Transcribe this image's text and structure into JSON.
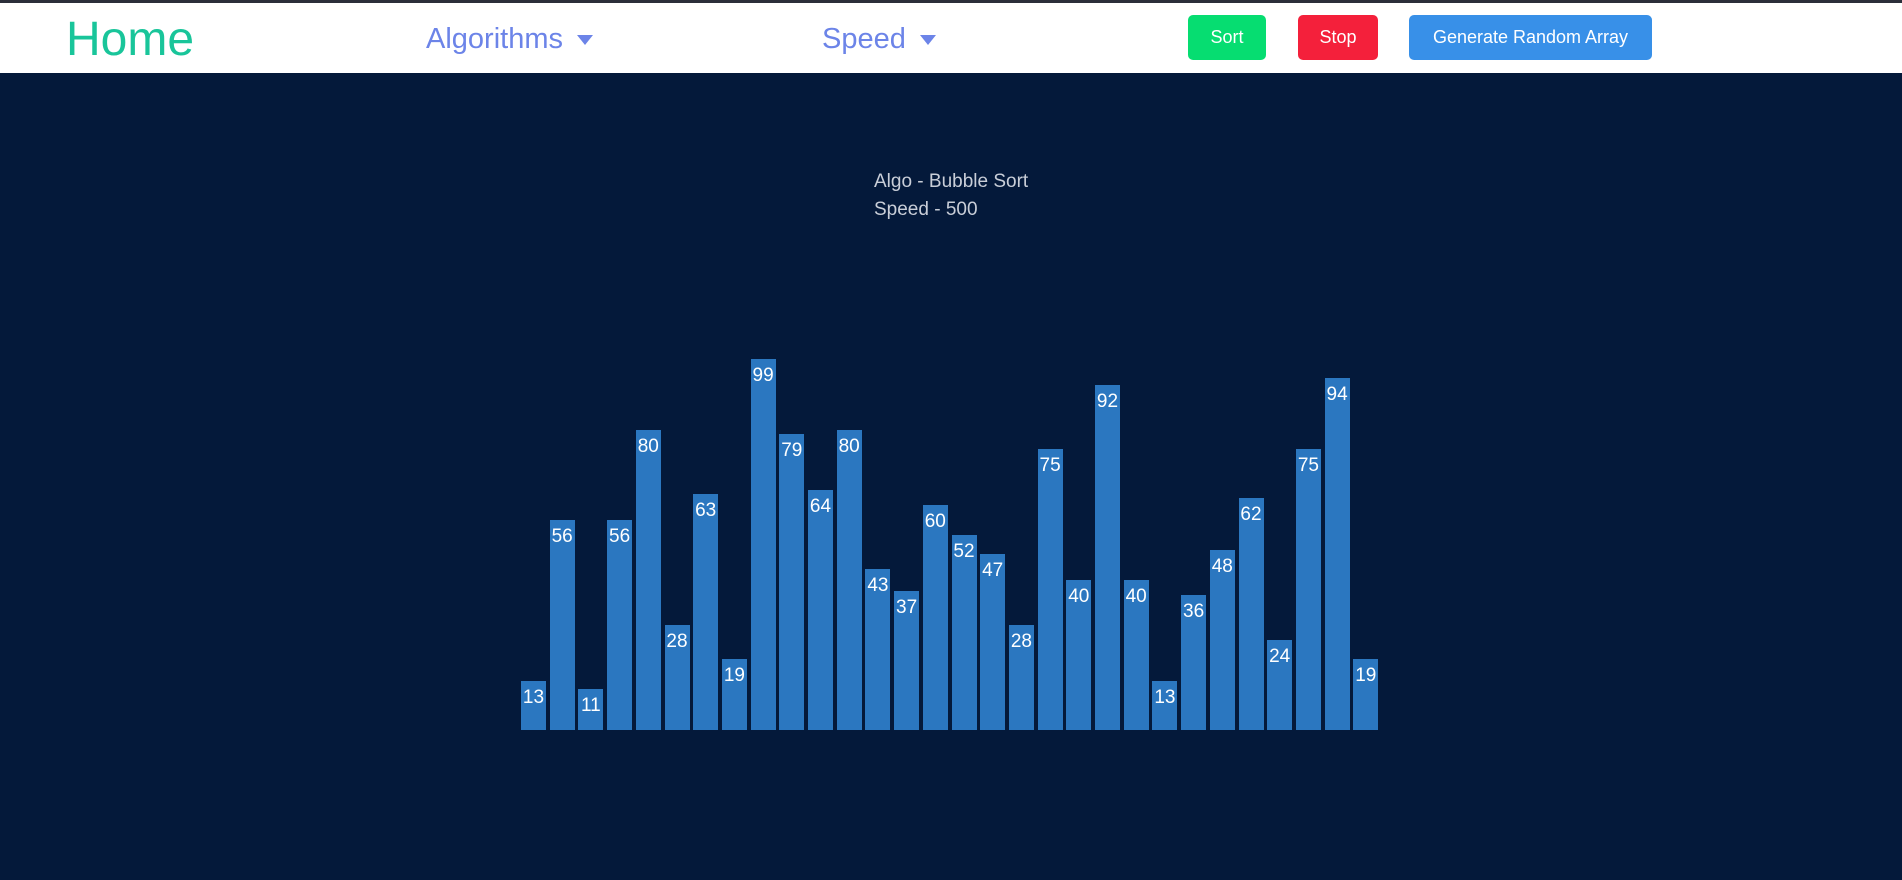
{
  "nav": {
    "brand": "Home",
    "algorithms_label": "Algorithms",
    "speed_label": "Speed",
    "sort_label": "Sort",
    "stop_label": "Stop",
    "generate_label": "Generate Random Array"
  },
  "info": {
    "algo_text": "Algo - Bubble Sort",
    "speed_text": "Speed - 500"
  },
  "colors": {
    "background": "#04193a",
    "bar": "#2b77c0",
    "brand": "#19c59a",
    "nav_link": "#6c84e8",
    "sort_button": "#06dd71",
    "stop_button": "#f4203b",
    "generate_button": "#3890e8"
  },
  "icons": {
    "dropdown": "caret-down-icon"
  },
  "chart_data": {
    "type": "bar",
    "values": [
      13,
      56,
      11,
      56,
      80,
      28,
      63,
      19,
      99,
      79,
      64,
      80,
      43,
      37,
      60,
      52,
      47,
      28,
      75,
      40,
      92,
      40,
      13,
      36,
      48,
      62,
      24,
      75,
      94,
      19
    ],
    "title": "",
    "xlabel": "",
    "ylabel": "",
    "ylim": [
      0,
      100
    ]
  }
}
